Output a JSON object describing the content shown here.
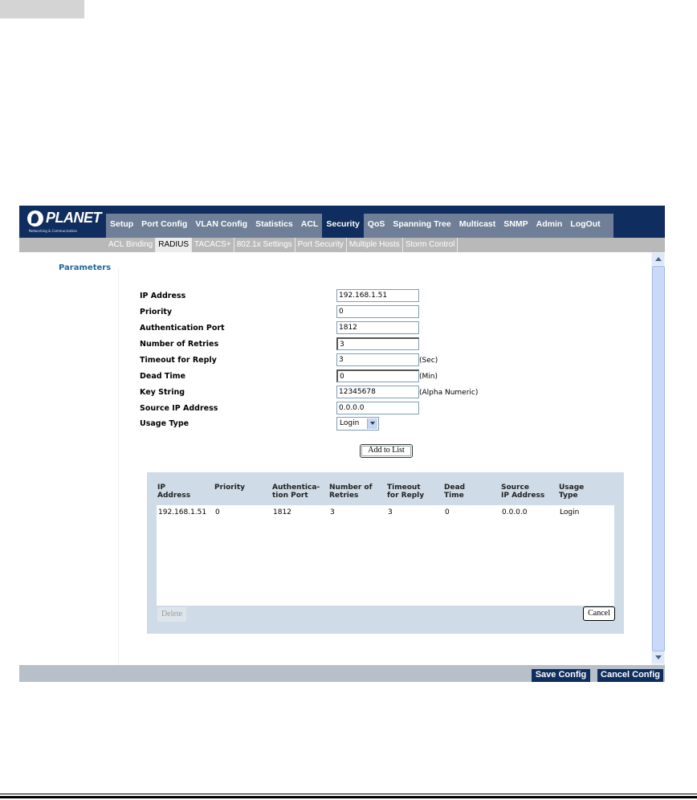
{
  "brand": {
    "name": "PLANET",
    "tagline": "Networking & Communication"
  },
  "menu": {
    "items": [
      "Setup",
      "Port Config",
      "VLAN Config",
      "Statistics",
      "ACL",
      "Security",
      "QoS",
      "Spanning Tree",
      "Multicast",
      "SNMP",
      "Admin",
      "LogOut"
    ],
    "active": "Security"
  },
  "submenu": {
    "items": [
      "ACL Binding",
      "RADIUS",
      "TACACS+",
      "802.1x Settings",
      "Port Security",
      "Multiple Hosts",
      "Storm Control"
    ],
    "active": "RADIUS"
  },
  "section_title": "Parameters",
  "form": {
    "ip_address": {
      "label": "IP Address",
      "value": "192.168.1.51"
    },
    "priority": {
      "label": "Priority",
      "value": "0"
    },
    "auth_port": {
      "label": "Authentication Port",
      "value": "1812"
    },
    "retries": {
      "label": "Number of Retries",
      "value": "3"
    },
    "timeout": {
      "label": "Timeout for Reply",
      "value": "3",
      "unit": "(Sec)"
    },
    "dead_time": {
      "label": "Dead Time",
      "value": "0",
      "unit": "(Min)"
    },
    "key_string": {
      "label": "Key String",
      "value": "12345678",
      "unit": "(Alpha Numeric)"
    },
    "source_ip": {
      "label": "Source IP Address",
      "value": "0.0.0.0"
    },
    "usage_type": {
      "label": "Usage Type",
      "value": "Login"
    }
  },
  "add_button": "Add to List",
  "table": {
    "headers": [
      [
        "IP",
        "Address"
      ],
      [
        "Priority",
        ""
      ],
      [
        "Authentica-",
        "tion Port"
      ],
      [
        "Number of",
        "Retries"
      ],
      [
        "Timeout",
        "for Reply"
      ],
      [
        "Dead",
        "Time"
      ],
      [
        "Source",
        "IP Address"
      ],
      [
        "Usage",
        "Type"
      ]
    ],
    "rows": [
      [
        "192.168.1.51",
        "0",
        "1812",
        "3",
        "3",
        "0",
        "0.0.0.0",
        "Login"
      ]
    ],
    "delete_label": "Delete",
    "cancel_label": "Cancel"
  },
  "footer": {
    "save": "Save Config",
    "cancel": "Cancel Config"
  }
}
